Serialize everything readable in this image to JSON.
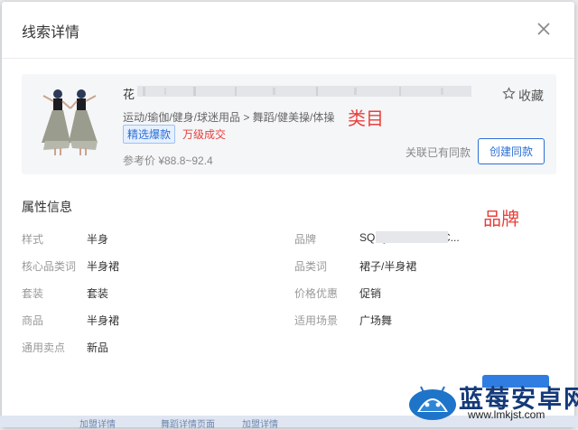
{
  "dialog": {
    "title": "线索详情"
  },
  "product": {
    "title_visible_char": "花",
    "favorite_label": "收藏",
    "category_path": "运动/瑜伽/健身/球迷用品 > 舞蹈/健美操/体操",
    "badges": [
      "精选爆款",
      "万级成交"
    ],
    "price": "参考价 ¥88.8~92.4",
    "linked_text": "关联已有同款",
    "create_button": "创建同款"
  },
  "annotations": {
    "category": "类目",
    "brand": "品牌"
  },
  "attributes": {
    "section_title": "属性信息",
    "left": [
      {
        "label": "样式",
        "value": "半身"
      },
      {
        "label": "核心品类词",
        "value": "半身裙"
      },
      {
        "label": "套装",
        "value": "套装"
      },
      {
        "label": "商品",
        "value": "半身裙"
      },
      {
        "label": "通用卖点",
        "value": "新品"
      }
    ],
    "right": [
      {
        "label": "品牌",
        "value": "SQ                    QUARE DANC..."
      },
      {
        "label": "品类词",
        "value": "裙子/半身裙"
      },
      {
        "label": "价格优惠",
        "value": "促销"
      },
      {
        "label": "适用场景",
        "value": "广场舞"
      }
    ]
  },
  "footer_strip": [
    "加盟详情",
    "舞蹈详情页面",
    "加盟详情"
  ],
  "watermark": {
    "name": "蓝莓安卓网",
    "url": "www.lmkjst.com"
  },
  "colors": {
    "accent": "#2b6fd6",
    "annotation_red": "#e8403b",
    "card_bg": "#f5f6f8"
  }
}
